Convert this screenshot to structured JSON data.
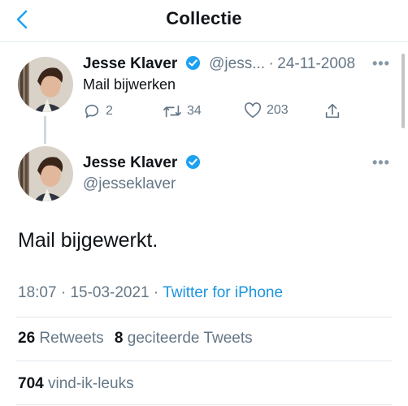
{
  "header": {
    "title": "Collectie"
  },
  "reply_tweet": {
    "name": "Jesse Klaver",
    "handle": "@jess...",
    "date_sep": "·",
    "date": "24-11-2008",
    "text": "Mail bijwerken",
    "replies": "2",
    "retweets": "34",
    "likes": "203"
  },
  "main_tweet": {
    "name": "Jesse Klaver",
    "handle": "@jesseklaver",
    "text": "Mail bijgewerkt.",
    "time": "18:07",
    "sep1": "·",
    "date": "15-03-2021",
    "sep2": "·",
    "source": "Twitter for iPhone"
  },
  "stats": {
    "retweets_count": "26",
    "retweets_label": "Retweets",
    "quotes_count": "8",
    "quotes_label": "geciteerde Tweets",
    "likes_count": "704",
    "likes_label": "vind-ik-leuks"
  },
  "colors": {
    "accent": "#1b95e0",
    "muted": "#657786",
    "verified": "#1da1f2"
  }
}
